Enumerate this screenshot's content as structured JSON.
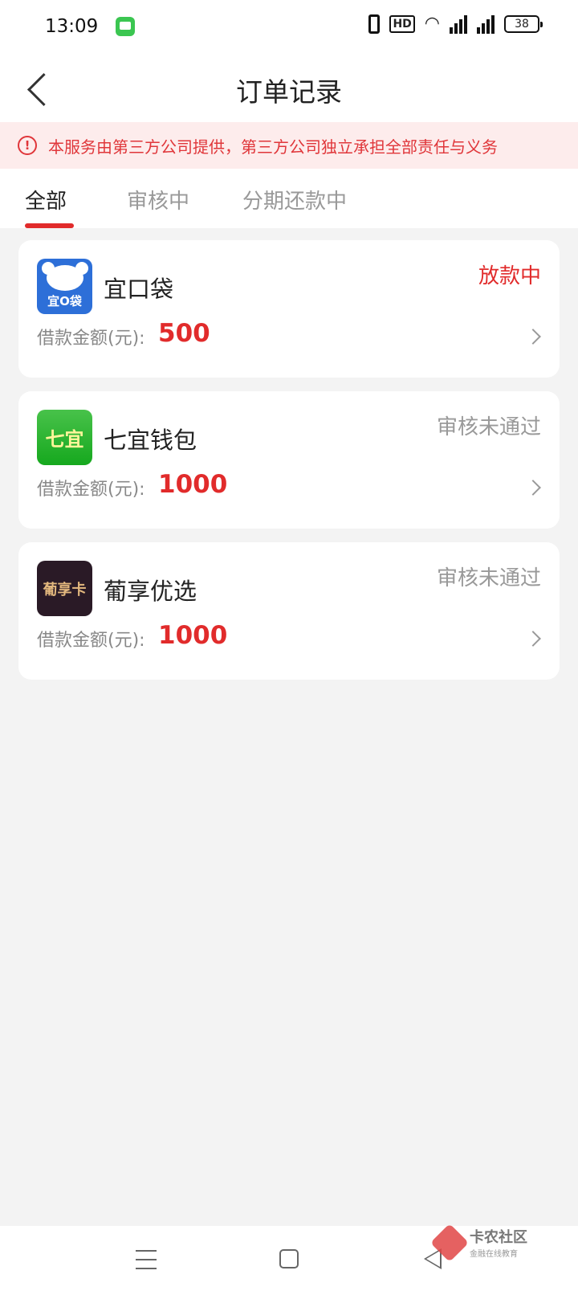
{
  "status_bar": {
    "time": "13:09",
    "battery": "38",
    "hd": "HD",
    "net1": "4G",
    "net2": "4G"
  },
  "nav": {
    "title": "订单记录"
  },
  "notice": {
    "text": "本服务由第三方公司提供，第三方公司独立承担全部责任与义务",
    "icon": "!"
  },
  "tabs": [
    {
      "label": "全部",
      "active": true
    },
    {
      "label": "审核中",
      "active": false
    },
    {
      "label": "分期还款中",
      "active": false
    }
  ],
  "amount_label": "借款金额(元):",
  "orders": [
    {
      "name": "宜口袋",
      "status": "放款中",
      "status_color": "#e12b2b",
      "amount": "500",
      "logo_text": "宜O袋"
    },
    {
      "name": "七宜钱包",
      "status": "审核未通过",
      "status_color": "#999999",
      "amount": "1000",
      "logo_text": "七宜"
    },
    {
      "name": "葡享优选",
      "status": "审核未通过",
      "status_color": "#999999",
      "amount": "1000",
      "logo_text": "葡享卡"
    }
  ],
  "watermark": {
    "main": "卡农社区",
    "sub": "金融在线教育"
  },
  "colors": {
    "accent": "#e12b2b",
    "notice_bg": "#fdecec"
  }
}
